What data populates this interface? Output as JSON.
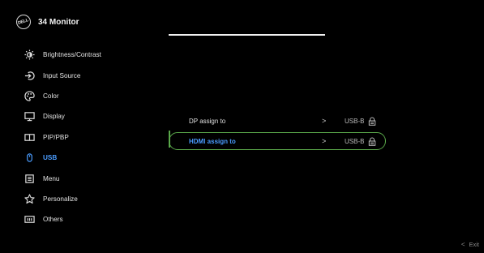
{
  "header": {
    "logo_text": "DELL",
    "title": "34 Monitor"
  },
  "menu": {
    "items": [
      {
        "label": "Brightness/Contrast",
        "icon": "brightness-icon"
      },
      {
        "label": "Input Source",
        "icon": "input-source-icon"
      },
      {
        "label": "Color",
        "icon": "color-icon"
      },
      {
        "label": "Display",
        "icon": "display-icon"
      },
      {
        "label": "PIP/PBP",
        "icon": "pip-pbp-icon"
      },
      {
        "label": "USB",
        "icon": "usb-icon",
        "active": true
      },
      {
        "label": "Menu",
        "icon": "menu-icon"
      },
      {
        "label": "Personalize",
        "icon": "star-icon"
      },
      {
        "label": "Others",
        "icon": "others-icon"
      }
    ]
  },
  "submenu": {
    "items": [
      {
        "label": "DP assign to",
        "arrow": ">",
        "value": "USB-B"
      },
      {
        "label": "HDMI assign to",
        "arrow": ">",
        "value": "USB-B",
        "highlighted": true
      }
    ]
  },
  "footer": {
    "exit_label": "Exit",
    "exit_chevron": "<"
  },
  "colors": {
    "accent_blue": "#4a9cff",
    "highlight_green": "#5aa84a",
    "background": "#000000"
  }
}
